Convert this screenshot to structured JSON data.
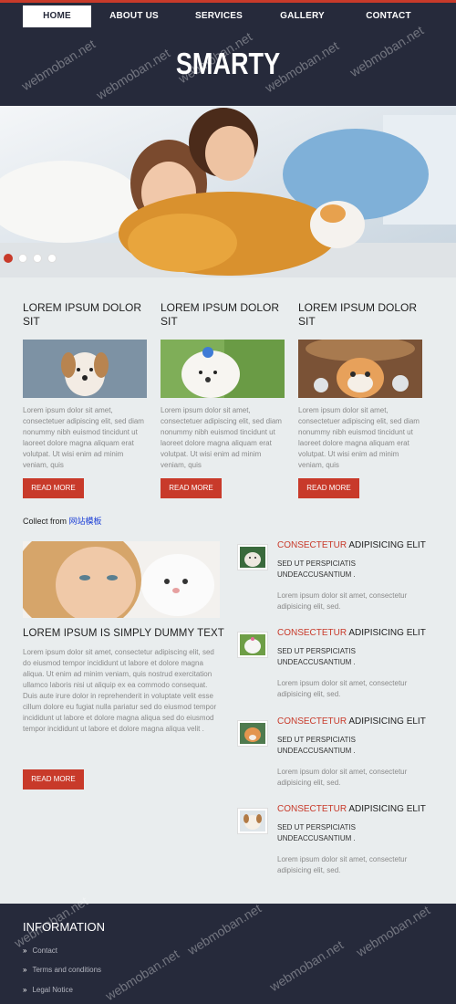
{
  "nav": {
    "items": [
      {
        "label": "HOME",
        "active": true
      },
      {
        "label": "ABOUT US",
        "active": false
      },
      {
        "label": "SERVICES",
        "active": false
      },
      {
        "label": "GALLERY",
        "active": false
      },
      {
        "label": "CONTACT",
        "active": false
      }
    ]
  },
  "header": {
    "logo": "SMARTY"
  },
  "colors": {
    "accent": "#c83a2a",
    "dark": "#262a3b",
    "background": "#e9edee"
  },
  "hero": {
    "slide_count": 4,
    "active_slide": 1
  },
  "columns": [
    {
      "title": "LOREM IPSUM DOLOR SIT",
      "text": "Lorem ipsum dolor sit amet, consectetuer adipiscing elit, sed diam nonummy nibh euismod tincidunt ut laoreet dolore magna aliquam erat volutpat. Ut wisi enim ad minim veniam, quis",
      "button": "READ MORE"
    },
    {
      "title": "LOREM IPSUM DOLOR SIT",
      "text": "Lorem ipsum dolor sit amet, consectetuer adipiscing elit, sed diam nonummy nibh euismod tincidunt ut laoreet dolore magna aliquam erat volutpat. Ut wisi enim ad minim veniam, quis",
      "button": "READ MORE"
    },
    {
      "title": "LOREM IPSUM DOLOR SIT",
      "text": "Lorem ipsum dolor sit amet, consectetuer adipiscing elit, sed diam nonummy nibh euismod tincidunt ut laoreet dolore magna aliquam erat volutpat. Ut wisi enim ad minim veniam, quis",
      "button": "READ MORE"
    }
  ],
  "collect": {
    "prefix": "Collect from ",
    "link": "网站模板"
  },
  "feature": {
    "title": "LOREM IPSUM IS SIMPLY DUMMY TEXT",
    "text": "Lorem ipsum dolor sit amet, consectetur adipiscing elit, sed do eiusmod tempor incididunt ut labore et dolore magna aliqua. Ut enim ad minim veniam, quis nostrud exercitation ullamco laboris nisi ut aliquip ex ea commodo consequat. Duis aute irure dolor in reprehenderit in voluptate velit esse cillum dolore eu fugiat nulla pariatur sed do eiusmod tempor incididunt ut labore et dolore magna aliqua sed do eiusmod tempor incididunt ut labore et dolore magna aliqua velit .",
    "button": "READ MORE"
  },
  "list": [
    {
      "highlight": "CONSECTETUR",
      "title": " ADIPISICING ELIT",
      "sub1": "SED UT PERSPICIATIS",
      "sub2": "UNDEACCUSANTIUM .",
      "text": "Lorem ipsum dolor sit amet, consectetur adipisicing elit, sed."
    },
    {
      "highlight": "CONSECTETUR",
      "title": " ADIPISICING ELIT",
      "sub1": "SED UT PERSPICIATIS",
      "sub2": "UNDEACCUSANTIUM .",
      "text": "Lorem ipsum dolor sit amet, consectetur adipisicing elit, sed."
    },
    {
      "highlight": "CONSECTETUR",
      "title": " ADIPISICING ELIT",
      "sub1": "SED UT PERSPICIATIS",
      "sub2": "UNDEACCUSANTIUM .",
      "text": "Lorem ipsum dolor sit amet, consectetur adipisicing elit, sed."
    },
    {
      "highlight": "CONSECTETUR",
      "title": " ADIPISICING ELIT",
      "sub1": "SED UT PERSPICIATIS",
      "sub2": "UNDEACCUSANTIUM .",
      "text": "Lorem ipsum dolor sit amet, consectetur adipisicing elit, sed."
    }
  ],
  "footer": {
    "title": "INFORMATION",
    "links": [
      "Contact",
      "Terms and conditions",
      "Legal Notice"
    ]
  },
  "watermark": "webmoban.net"
}
